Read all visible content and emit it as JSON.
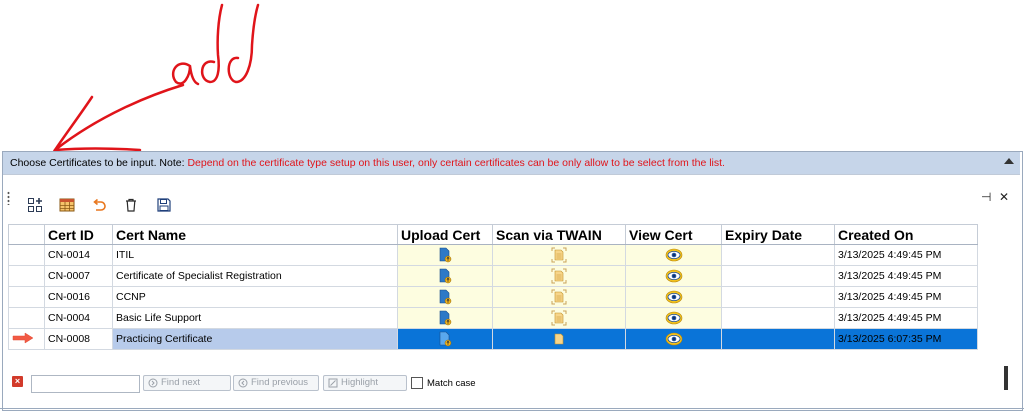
{
  "note": {
    "prefix": "Choose Certificates to be input. Note: ",
    "warning": "Depend on the certificate type setup on this user, only certain certificates can be only allow to be select from the list."
  },
  "annotation": {
    "text": "add",
    "color": "#e0141a"
  },
  "toolbar": {
    "buttons": [
      {
        "name": "add-row-icon"
      },
      {
        "name": "grid-view-icon"
      },
      {
        "name": "undo-icon"
      },
      {
        "name": "delete-icon"
      },
      {
        "name": "save-icon"
      }
    ],
    "pin_glyph": "⊣",
    "close_glyph": "✕"
  },
  "grid": {
    "columns": [
      "Cert ID",
      "Cert Name",
      "Upload Cert",
      "Scan via TWAIN",
      "View Cert",
      "Expiry Date",
      "Created On"
    ],
    "rows": [
      {
        "cert_id": "CN-0014",
        "cert_name": "ITIL",
        "expiry": "",
        "created": "3/13/2025 4:49:45 PM"
      },
      {
        "cert_id": "CN-0007",
        "cert_name": "Certificate of Specialist Registration",
        "expiry": "",
        "created": "3/13/2025 4:49:45 PM"
      },
      {
        "cert_id": "CN-0016",
        "cert_name": "CCNP",
        "expiry": "",
        "created": "3/13/2025 4:49:45 PM"
      },
      {
        "cert_id": "CN-0004",
        "cert_name": "Basic Life Support",
        "expiry": "",
        "created": "3/13/2025 4:49:45 PM"
      },
      {
        "cert_id": "CN-0008",
        "cert_name": "Practicing Certificate",
        "expiry": "",
        "created": "3/13/2025 6:07:35 PM",
        "selected": true
      }
    ],
    "selected_color": "#0a74d8"
  },
  "findbar": {
    "find_next": "Find next",
    "find_previous": "Find previous",
    "highlight": "Highlight",
    "match_case": "Match case",
    "value": ""
  }
}
